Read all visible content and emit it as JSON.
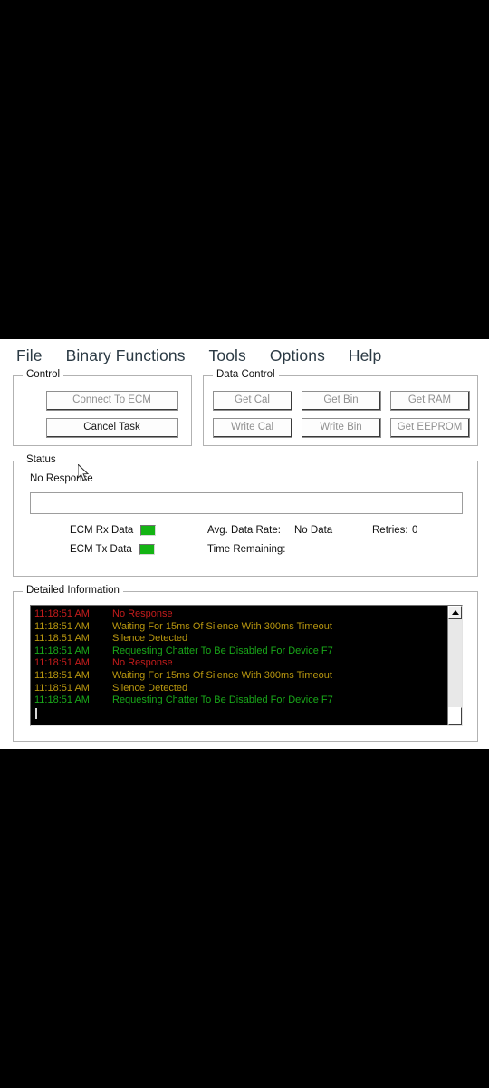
{
  "menubar": {
    "items": [
      {
        "label": "File",
        "name": "menu-file"
      },
      {
        "label": "Binary Functions",
        "name": "menu-binary-functions"
      },
      {
        "label": "Tools",
        "name": "menu-tools"
      },
      {
        "label": "Options",
        "name": "menu-options"
      },
      {
        "label": "Help",
        "name": "menu-help"
      }
    ]
  },
  "control_group": {
    "title": "Control",
    "connect_button": "Connect To ECM",
    "cancel_button": "Cancel Task"
  },
  "data_control_group": {
    "title": "Data Control",
    "get_cal": "Get Cal",
    "get_bin": "Get Bin",
    "get_ram": "Get RAM",
    "write_cal": "Write Cal",
    "write_bin": "Write Bin",
    "get_eeprom": "Get EEPROM"
  },
  "status_group": {
    "title": "Status",
    "message": "No Response",
    "progress_value": "",
    "rx_label": "ECM Rx Data",
    "tx_label": "ECM Tx Data",
    "rx_led_color": "#14b414",
    "tx_led_color": "#14b414",
    "data_rate_label": "Avg. Data Rate:",
    "data_rate_value": "No Data",
    "retries_label": "Retries:",
    "retries_value": "0",
    "time_remaining_label": "Time Remaining:",
    "time_remaining_value": ""
  },
  "detail_group": {
    "title": "Detailed Information",
    "colors": {
      "red": "#c41c1c",
      "yellow": "#b9970f",
      "green": "#19a819",
      "background": "#000000"
    },
    "log_lines": [
      {
        "time": "11:18:51 AM",
        "message": "No Response",
        "color": "red"
      },
      {
        "time": "11:18:51 AM",
        "message": "Waiting For 15ms Of Silence With 300ms Timeout",
        "color": "yellow"
      },
      {
        "time": "11:18:51 AM",
        "message": "Silence Detected",
        "color": "yellow"
      },
      {
        "time": "11:18:51 AM",
        "message": "Requesting Chatter To Be Disabled For Device F7",
        "color": "green"
      },
      {
        "time": "11:18:51 AM",
        "message": "No Response",
        "color": "red"
      },
      {
        "time": "11:18:51 AM",
        "message": "Waiting For 15ms Of Silence With 300ms Timeout",
        "color": "yellow"
      },
      {
        "time": "11:18:51 AM",
        "message": "Silence Detected",
        "color": "yellow"
      },
      {
        "time": "11:18:51 AM",
        "message": "Requesting Chatter To Be Disabled For Device F7",
        "color": "green"
      }
    ],
    "scrollbar": {
      "up_icon": "triangle-up-icon",
      "down_icon": "triangle-down-icon"
    }
  }
}
